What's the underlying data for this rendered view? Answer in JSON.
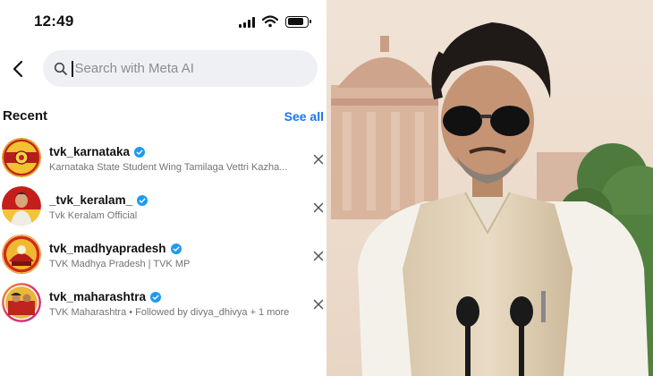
{
  "status_bar": {
    "time": "12:49",
    "battery_level": 0.85
  },
  "search": {
    "placeholder": "Search with Meta AI",
    "value": ""
  },
  "recent": {
    "title": "Recent",
    "see_all": "See all"
  },
  "accounts": [
    {
      "username": "tvk_karnataka",
      "subtitle": "Karnataka State Student Wing Tamilaga Vettri Kazha..."
    },
    {
      "username": "_tvk_keralam_",
      "subtitle": "Tvk Keralam Official"
    },
    {
      "username": "tvk_madhyapradesh",
      "subtitle": "TVK Madhya Pradesh | TVK MP"
    },
    {
      "username": "tvk_maharashtra",
      "subtitle": "TVK Maharashtra • Followed by divya_dhivya + 1 more"
    }
  ],
  "colors": {
    "accent": "#1877f2",
    "verified": "#1d9bf0",
    "search_bg": "#eef0f4"
  },
  "icons": [
    "signal-icon",
    "wifi-icon",
    "battery-icon",
    "back-arrow-icon",
    "search-icon",
    "verified-badge-icon",
    "close-icon"
  ]
}
